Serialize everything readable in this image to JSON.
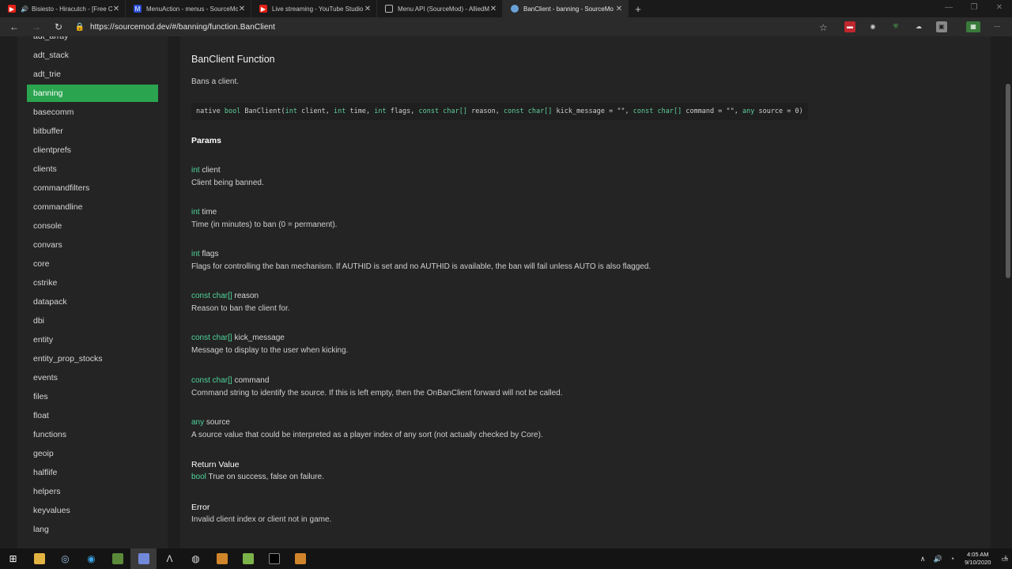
{
  "browser": {
    "tabs": [
      {
        "title": "Bisiesto - Hiracutch - [Free C",
        "icon": "youtube-icon"
      },
      {
        "title": "MenuAction - menus - SourceMo",
        "icon": "sourcemod-icon"
      },
      {
        "title": "Live streaming - YouTube Studio",
        "icon": "youtube-icon"
      },
      {
        "title": "Menu API (SourceMod) - AlliedM",
        "icon": "page-icon"
      },
      {
        "title": "BanClient - banning - SourceMo",
        "icon": "sourcemod-icon"
      }
    ],
    "url": "https://sourcemod.dev/#/banning/function.BanClient"
  },
  "sidebar": {
    "items": [
      "adt_array",
      "adt_stack",
      "adt_trie",
      "banning",
      "basecomm",
      "bitbuffer",
      "clientprefs",
      "clients",
      "commandfilters",
      "commandline",
      "console",
      "convars",
      "core",
      "cstrike",
      "datapack",
      "dbi",
      "entity",
      "entity_prop_stocks",
      "events",
      "files",
      "float",
      "functions",
      "geoip",
      "halflife",
      "helpers",
      "keyvalues",
      "lang"
    ],
    "active": "banning"
  },
  "doc": {
    "title": "BanClient Function",
    "description": "Bans a client.",
    "signature": {
      "parts": [
        {
          "t": "native ",
          "k": false
        },
        {
          "t": "bool",
          "k": true
        },
        {
          "t": " BanClient(",
          "k": false
        },
        {
          "t": "int",
          "k": true
        },
        {
          "t": " client, ",
          "k": false
        },
        {
          "t": "int",
          "k": true
        },
        {
          "t": " time, ",
          "k": false
        },
        {
          "t": "int",
          "k": true
        },
        {
          "t": " flags, ",
          "k": false
        },
        {
          "t": "const char[]",
          "k": true
        },
        {
          "t": " reason, ",
          "k": false
        },
        {
          "t": "const char[]",
          "k": true
        },
        {
          "t": " kick_message = \"\", ",
          "k": false
        },
        {
          "t": "const char[]",
          "k": true
        },
        {
          "t": " command = \"\", ",
          "k": false
        },
        {
          "t": "any",
          "k": true
        },
        {
          "t": " source = 0)",
          "k": false
        }
      ]
    },
    "params_heading": "Params",
    "params": [
      {
        "type": "int",
        "name": "client",
        "desc": "Client being banned."
      },
      {
        "type": "int",
        "name": "time",
        "desc": "Time (in minutes) to ban (0 = permanent)."
      },
      {
        "type": "int",
        "name": "flags",
        "desc": "Flags for controlling the ban mechanism. If AUTHID is set and no AUTHID is available, the ban will fail unless AUTO is also flagged."
      },
      {
        "type": "const char[]",
        "name": "reason",
        "desc": "Reason to ban the client for."
      },
      {
        "type": "const char[]",
        "name": "kick_message",
        "desc": "Message to display to the user when kicking."
      },
      {
        "type": "const char[]",
        "name": "command",
        "desc": "Command string to identify the source. If this is left empty, then the OnBanClient forward will not be called."
      },
      {
        "type": "any",
        "name": "source",
        "desc": "A source value that could be interpreted as a player index of any sort (not actually checked by Core)."
      }
    ],
    "return_heading": "Return Value",
    "return_type": "bool",
    "return_desc": "True on success, false on failure.",
    "error_heading": "Error",
    "error_desc": "Invalid client index or client not in game."
  },
  "taskbar": {
    "time": "4:05 AM",
    "date": "9/10/2020",
    "notifications": "5"
  },
  "colors": {
    "accent_green": "#2aa44f",
    "type_green": "#4fd49b"
  }
}
